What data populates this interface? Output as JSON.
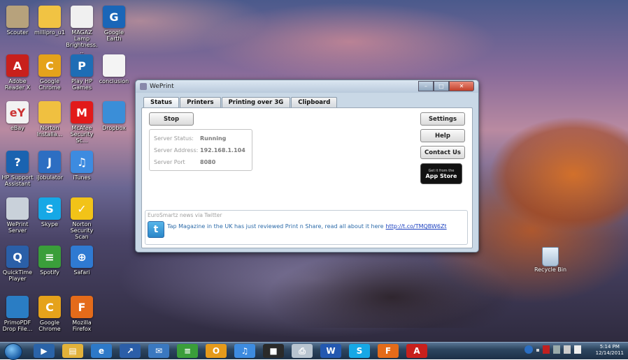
{
  "desktop": {
    "icons": [
      {
        "label": "Scouter",
        "color": "#b7a27c",
        "glyph": ""
      },
      {
        "label": "millipro_u1",
        "color": "#f1c343",
        "glyph": ""
      },
      {
        "label": "MAGAZ Lamp Brightness...",
        "color": "#f0f0f0",
        "glyph": ""
      },
      {
        "label": "Google Earth",
        "color": "#1a66b8",
        "glyph": "G"
      },
      {
        "label": "Adobe Reader X",
        "color": "#c8201c",
        "glyph": "A"
      },
      {
        "label": "Google Chrome",
        "color": "#e5a21b",
        "glyph": "C"
      },
      {
        "label": "Play HP Games",
        "color": "#1e6db5",
        "glyph": "P"
      },
      {
        "label": "conclusion",
        "color": "#f4f4f4",
        "glyph": ""
      },
      {
        "label": "eBay",
        "color": "#f2f2f2",
        "glyph": "eY"
      },
      {
        "label": "Norton Installa...",
        "color": "#f0c040",
        "glyph": ""
      },
      {
        "label": "McAfee Security Sc...",
        "color": "#e21a1a",
        "glyph": "M"
      },
      {
        "label": "Dropbox",
        "color": "#3a8ed8",
        "glyph": ""
      },
      {
        "label": "HP Support Assistant",
        "color": "#1a63b0",
        "glyph": "?"
      },
      {
        "label": "iJobulator",
        "color": "#2d6ec2",
        "glyph": "J"
      },
      {
        "label": "iTunes",
        "color": "#3d8be0",
        "glyph": "♫"
      },
      {
        "label": "WePrint Server",
        "color": "#c9d1da",
        "glyph": ""
      },
      {
        "label": "Skype",
        "color": "#16a8e6",
        "glyph": "S"
      },
      {
        "label": "Norton Security Scan",
        "color": "#f2c318",
        "glyph": "✓"
      },
      {
        "label": "QuickTime Player",
        "color": "#2a5fa8",
        "glyph": "Q"
      },
      {
        "label": "Spotify",
        "color": "#3a9e3a",
        "glyph": "≡"
      },
      {
        "label": "Safari",
        "color": "#2f7ad2",
        "glyph": "⊕"
      },
      {
        "label": "PrimoPDF Drop File...",
        "color": "#2a7dc4",
        "glyph": ""
      },
      {
        "label": "Google Chrome",
        "color": "#e5a21b",
        "glyph": "C"
      },
      {
        "label": "Mozilla Firefox",
        "color": "#e46b1a",
        "glyph": "F"
      }
    ],
    "recycle_bin": {
      "label": "Recycle Bin"
    }
  },
  "window": {
    "title": "WePrint",
    "tabs": [
      "Status",
      "Printers",
      "Printing over 3G",
      "Clipboard"
    ],
    "active_tab": "Status",
    "stop_button": "Stop",
    "server": {
      "status_label": "Server Status:",
      "status_value": "Running",
      "address_label": "Server Address:",
      "address_value": "192.168.1.104",
      "port_label": "Server Port",
      "port_value": "8080"
    },
    "buttons": {
      "settings": "Settings",
      "help": "Help",
      "contact": "Contact Us"
    },
    "appstore": {
      "line1": "Get it from the",
      "line2": "App Store"
    },
    "twitter": {
      "heading": "EuroSmartz news via Twitter",
      "message": "Tap Magazine in the UK has just reviewed Print n Share, read all about it here",
      "link": "http://t.co/TMQBW6Zt"
    }
  },
  "taskbar": {
    "time": "5:14 PM",
    "date": "12/14/2011",
    "apps": [
      {
        "name": "media",
        "color": "#2a63a8",
        "glyph": "▶"
      },
      {
        "name": "explorer",
        "color": "#e2b23a",
        "glyph": "▤"
      },
      {
        "name": "internet-explorer",
        "color": "#2d79c8",
        "glyph": "e"
      },
      {
        "name": "stocks",
        "color": "#2b5ea8",
        "glyph": "↗"
      },
      {
        "name": "mail",
        "color": "#3a78c0",
        "glyph": "✉"
      },
      {
        "name": "spotify",
        "color": "#3a9e3a",
        "glyph": "≡"
      },
      {
        "name": "outlook",
        "color": "#e59a1b",
        "glyph": "O"
      },
      {
        "name": "itunes",
        "color": "#3d8be0",
        "glyph": "♫"
      },
      {
        "name": "app-dark",
        "color": "#2a2a2a",
        "glyph": "■"
      },
      {
        "name": "weprint",
        "color": "#b8c4d0",
        "glyph": "⎙"
      },
      {
        "name": "word",
        "color": "#2358b0",
        "glyph": "W"
      },
      {
        "name": "skype",
        "color": "#16a8e6",
        "glyph": "S"
      },
      {
        "name": "firefox",
        "color": "#e46b1a",
        "glyph": "F"
      },
      {
        "name": "acrobat",
        "color": "#c8201c",
        "glyph": "A"
      }
    ]
  }
}
